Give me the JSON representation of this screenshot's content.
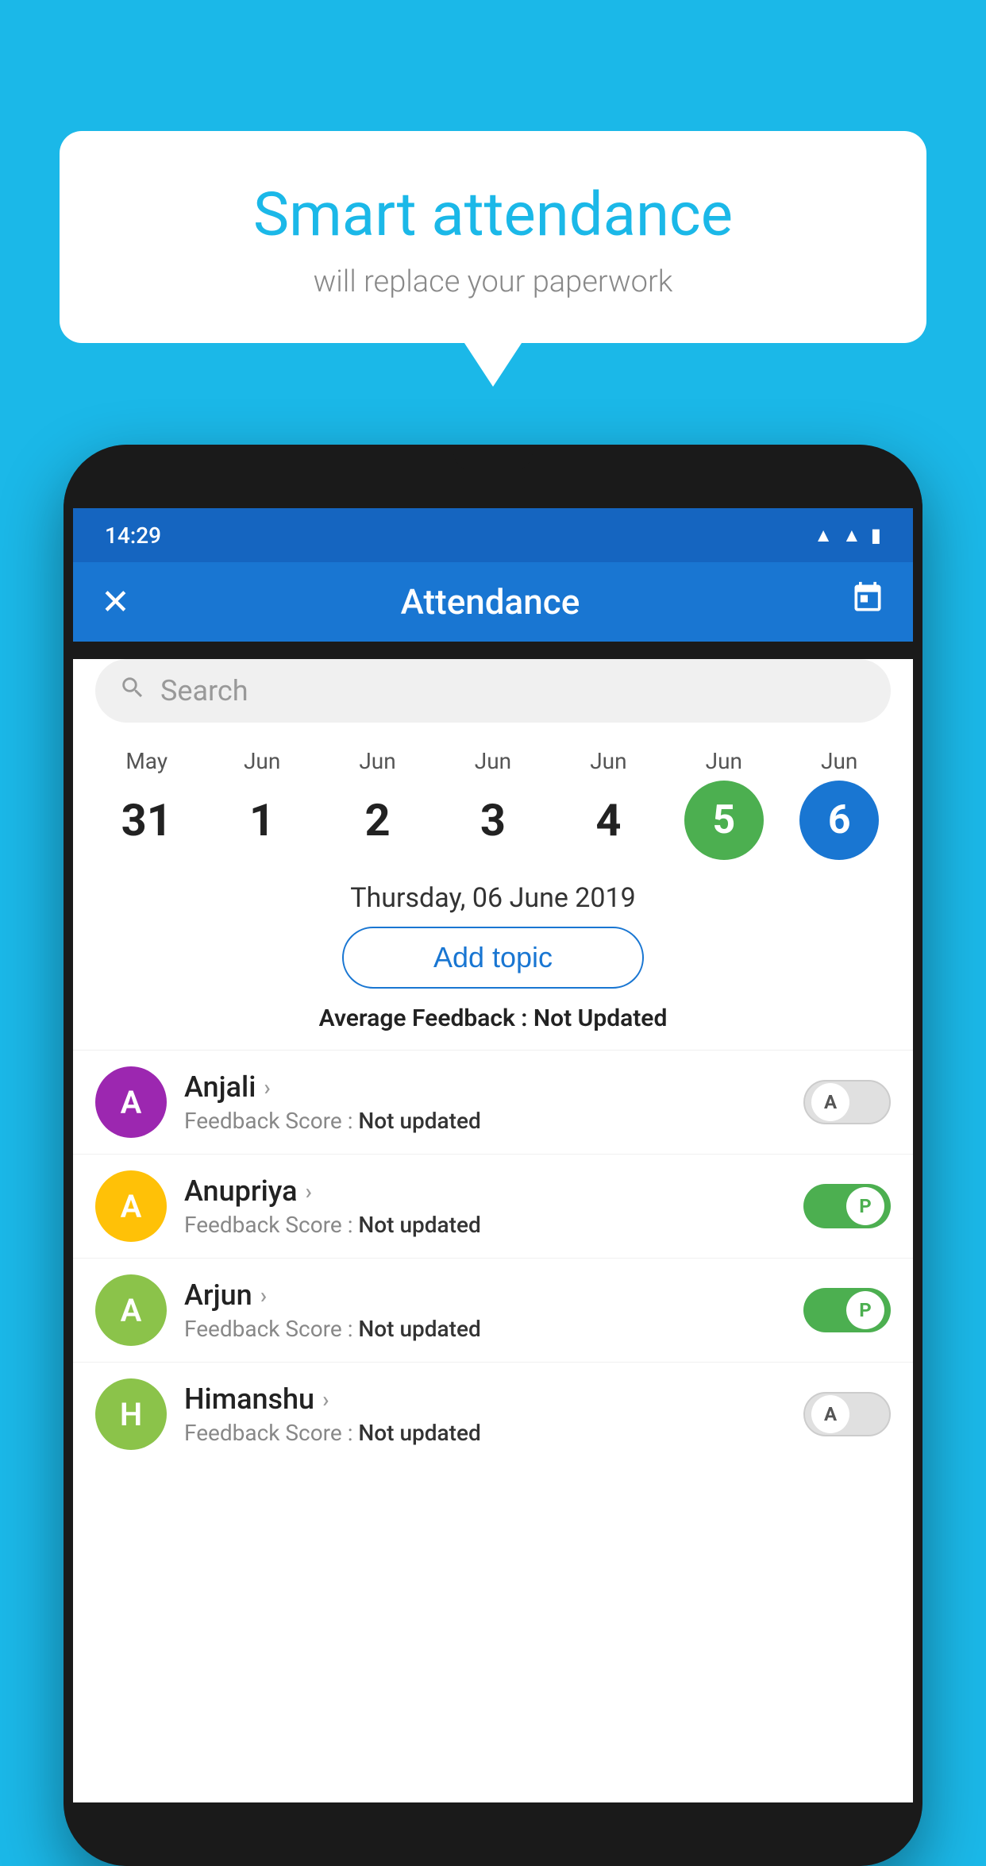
{
  "background_color": "#1BB8E8",
  "speech_bubble": {
    "title": "Smart attendance",
    "subtitle": "will replace your paperwork"
  },
  "phone": {
    "status_bar": {
      "time": "14:29"
    },
    "top_bar": {
      "title": "Attendance",
      "close_label": "✕",
      "calendar_label": "📅"
    },
    "search": {
      "placeholder": "Search"
    },
    "calendar": {
      "columns": [
        {
          "month": "May",
          "day": "31",
          "style": "normal"
        },
        {
          "month": "Jun",
          "day": "1",
          "style": "normal"
        },
        {
          "month": "Jun",
          "day": "2",
          "style": "normal"
        },
        {
          "month": "Jun",
          "day": "3",
          "style": "normal"
        },
        {
          "month": "Jun",
          "day": "4",
          "style": "normal"
        },
        {
          "month": "Jun",
          "day": "5",
          "style": "today"
        },
        {
          "month": "Jun",
          "day": "6",
          "style": "selected"
        }
      ]
    },
    "selected_date": "Thursday, 06 June 2019",
    "add_topic_label": "Add topic",
    "avg_feedback_label": "Average Feedback :",
    "avg_feedback_value": "Not Updated",
    "students": [
      {
        "name": "Anjali",
        "feedback": "Feedback Score :",
        "feedback_value": "Not updated",
        "avatar_letter": "A",
        "avatar_color": "#9C27B0",
        "toggle_state": "off",
        "toggle_label": "A"
      },
      {
        "name": "Anupriya",
        "feedback": "Feedback Score :",
        "feedback_value": "Not updated",
        "avatar_letter": "A",
        "avatar_color": "#FFC107",
        "toggle_state": "on",
        "toggle_label": "P"
      },
      {
        "name": "Arjun",
        "feedback": "Feedback Score :",
        "feedback_value": "Not updated",
        "avatar_letter": "A",
        "avatar_color": "#8BC34A",
        "toggle_state": "on",
        "toggle_label": "P"
      },
      {
        "name": "Himanshu",
        "feedback": "Feedback Score :",
        "feedback_value": "Not updated",
        "avatar_letter": "H",
        "avatar_color": "#8BC34A",
        "toggle_state": "off",
        "toggle_label": "A"
      }
    ]
  }
}
